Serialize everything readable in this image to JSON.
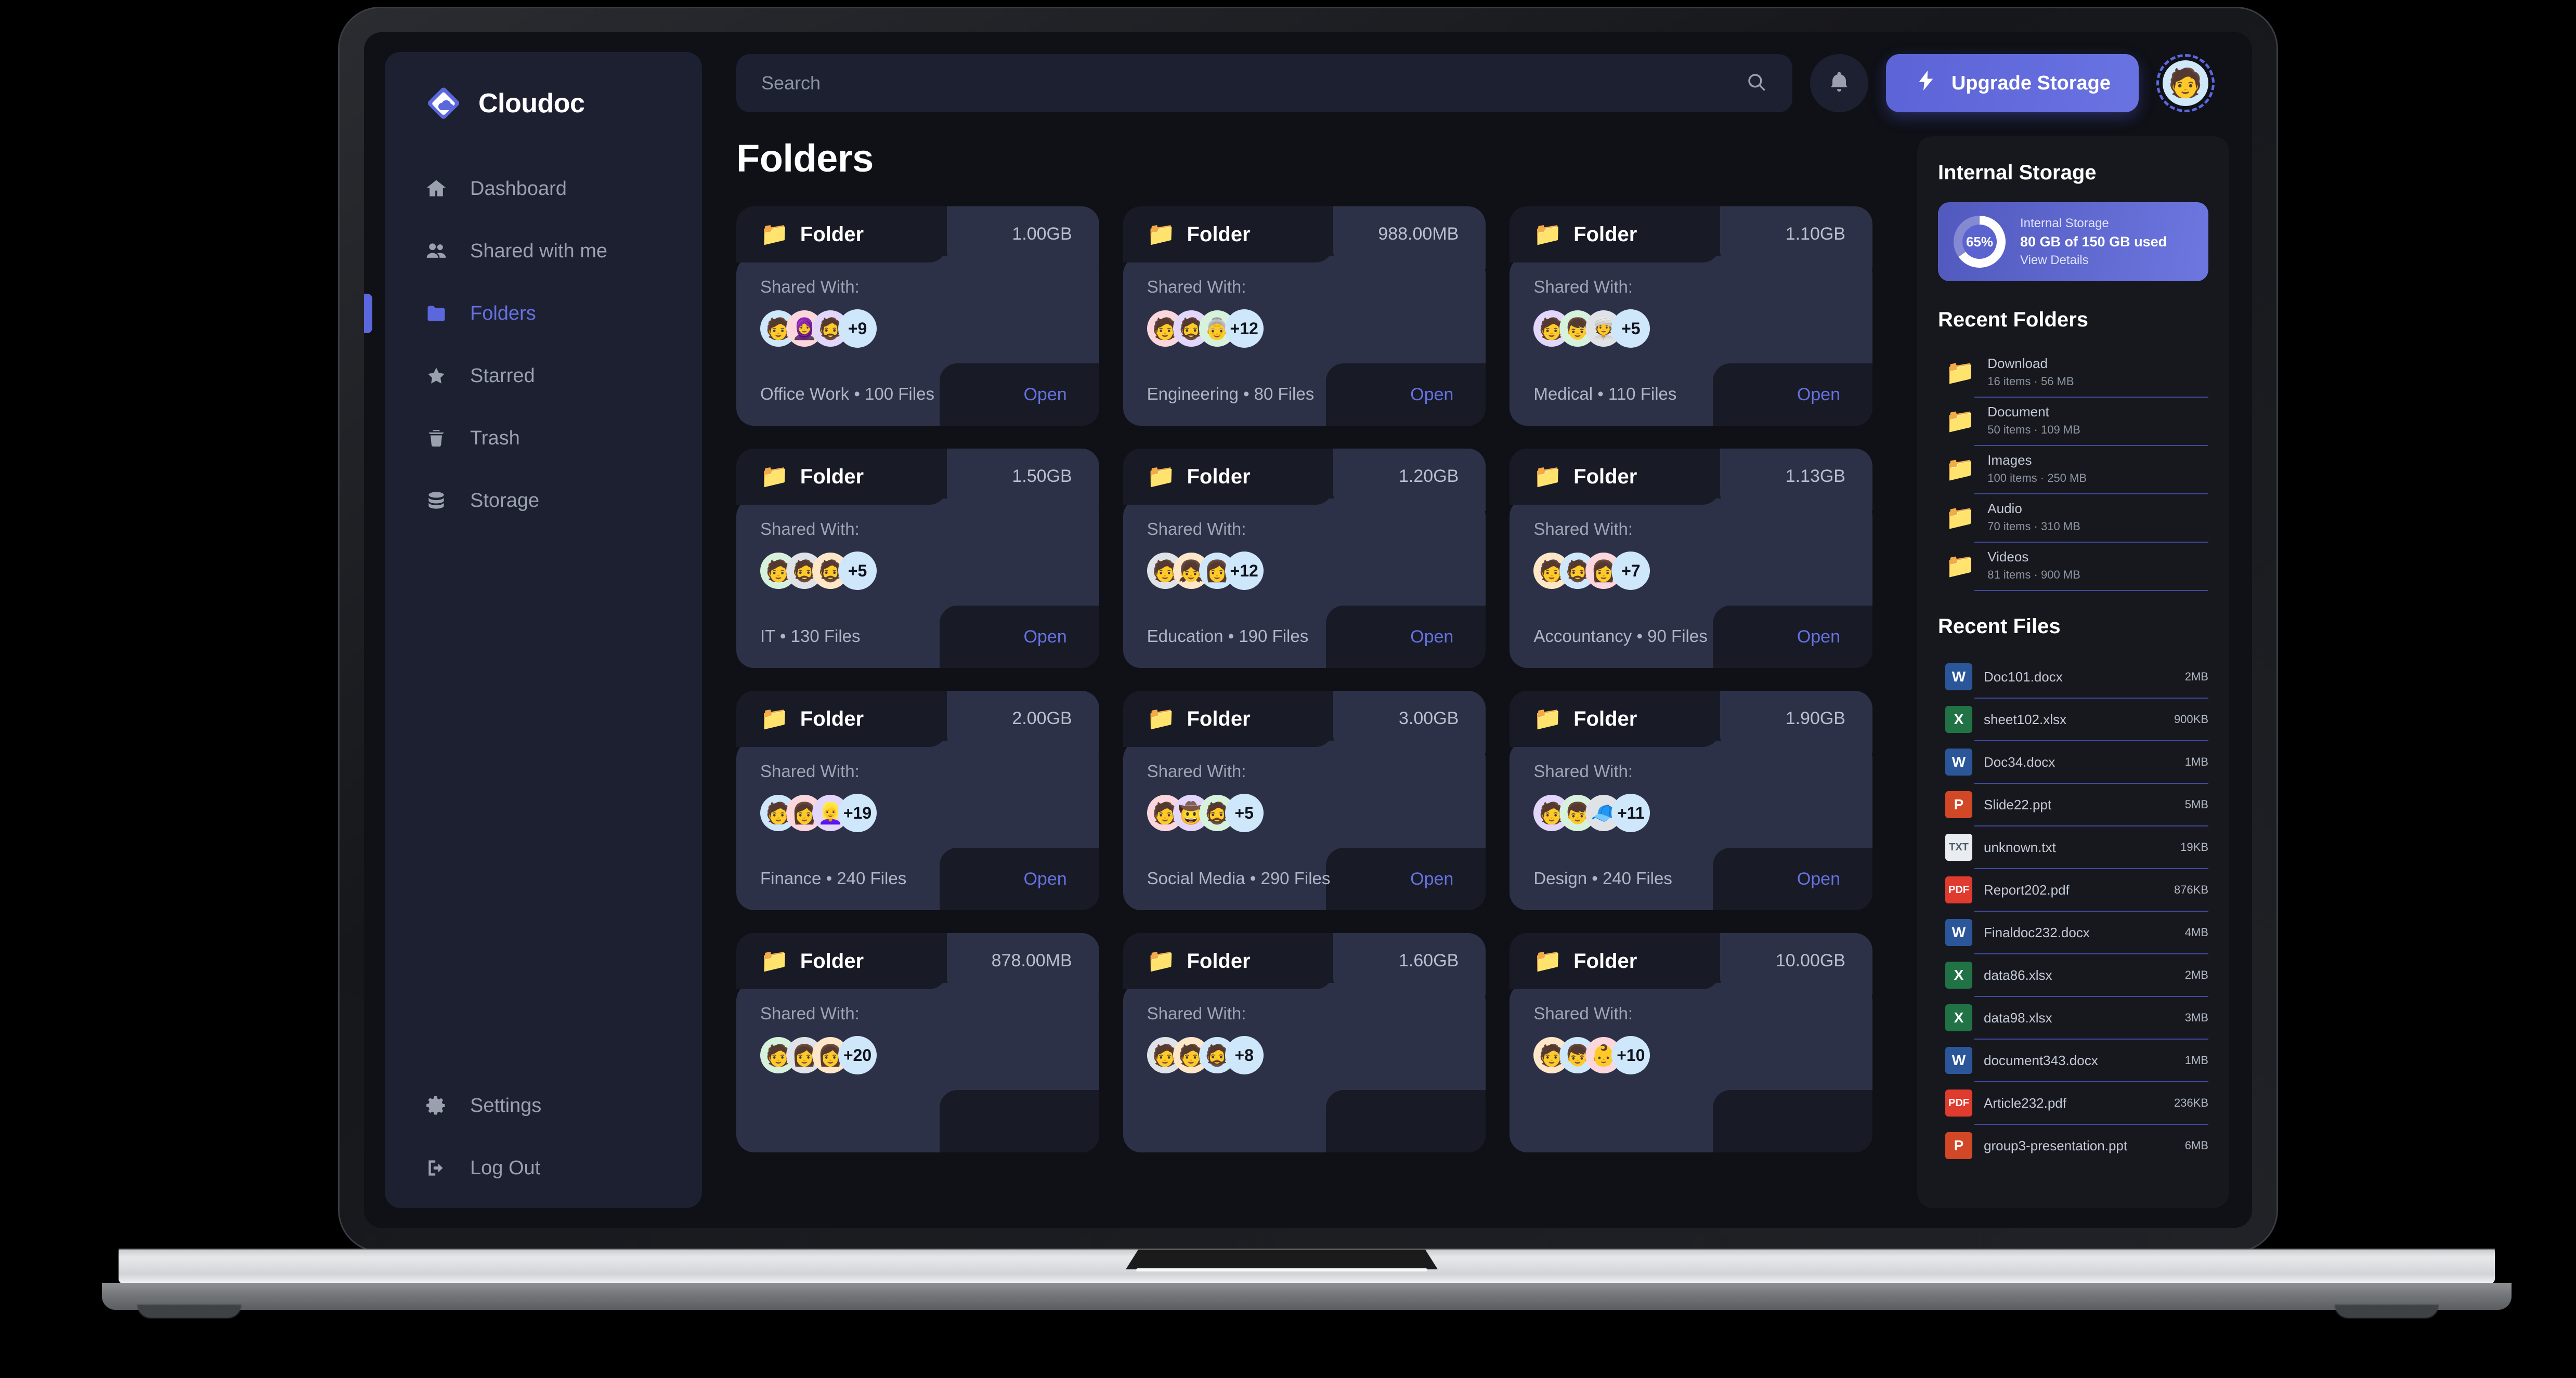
{
  "brand": {
    "name": "Cloudoc",
    "logo_icon": "cloud-diamond-logo",
    "accent": "#5b67dd"
  },
  "sidebar": {
    "items": [
      {
        "label": "Dashboard",
        "icon": "home-icon",
        "active": false
      },
      {
        "label": "Shared with me",
        "icon": "people-icon",
        "active": false
      },
      {
        "label": "Folders",
        "icon": "folder-icon",
        "active": true
      },
      {
        "label": "Starred",
        "icon": "star-icon",
        "active": false
      },
      {
        "label": "Trash",
        "icon": "trash-icon",
        "active": false
      },
      {
        "label": "Storage",
        "icon": "database-icon",
        "active": false
      }
    ],
    "bottom_items": [
      {
        "label": "Settings",
        "icon": "gear-icon"
      },
      {
        "label": "Log Out",
        "icon": "logout-icon"
      }
    ]
  },
  "topbar": {
    "search_placeholder": "Search",
    "search_value": "",
    "search_icon": "search-icon",
    "notifications_icon": "bell-icon",
    "upgrade_label": "Upgrade Storage",
    "upgrade_icon": "lightning-bolt-icon",
    "avatar_icon": "user-avatar"
  },
  "main": {
    "page_title": "Folders",
    "card_label": "Folder",
    "shared_with_label": "Shared With:",
    "open_label": "Open",
    "folder_icon": "folder-emoji",
    "cards": [
      {
        "size": "1.00GB",
        "extra": "+9",
        "name": "Office Work",
        "files": "100 Files",
        "footer": "Office Work • 100 Files",
        "avatars": [
          "🧑",
          "🧕",
          "🧔"
        ]
      },
      {
        "size": "988.00MB",
        "extra": "+12",
        "name": "Engineering",
        "files": "80 Files",
        "footer": "Engineering • 80 Files",
        "avatars": [
          "🧑",
          "🧔",
          "👵"
        ]
      },
      {
        "size": "1.10GB",
        "extra": "+5",
        "name": "Medical",
        "files": "110 Files",
        "footer": "Medical • 110 Files",
        "avatars": [
          "🧑",
          "👦",
          "👳"
        ]
      },
      {
        "size": "1.50GB",
        "extra": "+5",
        "name": "IT",
        "files": "130 Files",
        "footer": "IT • 130 Files",
        "avatars": [
          "🧑",
          "🧔",
          "🧔"
        ]
      },
      {
        "size": "1.20GB",
        "extra": "+12",
        "name": "Education",
        "files": "190 Files",
        "footer": "Education • 190 Files",
        "avatars": [
          "🧑",
          "👧",
          "👩"
        ]
      },
      {
        "size": "1.13GB",
        "extra": "+7",
        "name": "Accountancy",
        "files": "90 Files",
        "footer": "Accountancy • 90 Files",
        "avatars": [
          "🧑",
          "🧔",
          "👩"
        ]
      },
      {
        "size": "2.00GB",
        "extra": "+19",
        "name": "Finance",
        "files": "240 Files",
        "footer": "Finance • 240 Files",
        "avatars": [
          "🧑",
          "👩",
          "👱‍♀️"
        ]
      },
      {
        "size": "3.00GB",
        "extra": "+5",
        "name": "Social Media",
        "files": "290 Files",
        "footer": "Social Media • 290 Files",
        "avatars": [
          "🧑",
          "🤠",
          "🧔"
        ]
      },
      {
        "size": "1.90GB",
        "extra": "+11",
        "name": "Design",
        "files": "240 Files",
        "footer": "Design • 240 Files",
        "avatars": [
          "🧑",
          "👦",
          "🧢"
        ]
      },
      {
        "size": "878.00MB",
        "extra": "+20",
        "name": "",
        "files": "",
        "footer": "",
        "avatars": [
          "🧑",
          "👩",
          "👩"
        ]
      },
      {
        "size": "1.60GB",
        "extra": "+8",
        "name": "",
        "files": "",
        "footer": "",
        "avatars": [
          "🧑",
          "🧑",
          "🧔"
        ]
      },
      {
        "size": "10.00GB",
        "extra": "+10",
        "name": "",
        "files": "",
        "footer": "",
        "avatars": [
          "🧑",
          "👦",
          "👶"
        ]
      }
    ]
  },
  "rail": {
    "storage_heading": "Internal Storage",
    "storage_card": {
      "percent": "65%",
      "percent_value": 65,
      "title": "Internal Storage",
      "used": "80 GB of 150 GB used",
      "link": "View Details"
    },
    "recent_folders_heading": "Recent Folders",
    "recent_folders": [
      {
        "name": "Download",
        "meta": "16 items · 56 MB",
        "icon": "folder-emoji"
      },
      {
        "name": "Document",
        "meta": "50 items · 109 MB",
        "icon": "folder-emoji"
      },
      {
        "name": "Images",
        "meta": "100 items · 250 MB",
        "icon": "folder-emoji"
      },
      {
        "name": "Audio",
        "meta": "70 items · 310 MB",
        "icon": "folder-emoji"
      },
      {
        "name": "Videos",
        "meta": "81 items · 900 MB",
        "icon": "folder-emoji"
      }
    ],
    "recent_files_heading": "Recent Files",
    "recent_files": [
      {
        "name": "Doc101.docx",
        "size": "2MB",
        "type": "word",
        "glyph": "W"
      },
      {
        "name": "sheet102.xlsx",
        "size": "900KB",
        "type": "excel",
        "glyph": "X"
      },
      {
        "name": "Doc34.docx",
        "size": "1MB",
        "type": "word",
        "glyph": "W"
      },
      {
        "name": "Slide22.ppt",
        "size": "5MB",
        "type": "ppt",
        "glyph": "P"
      },
      {
        "name": "unknown.txt",
        "size": "19KB",
        "type": "txt",
        "glyph": "TXT"
      },
      {
        "name": "Report202.pdf",
        "size": "876KB",
        "type": "pdf",
        "glyph": "PDF"
      },
      {
        "name": "Finaldoc232.docx",
        "size": "4MB",
        "type": "word",
        "glyph": "W"
      },
      {
        "name": "data86.xlsx",
        "size": "2MB",
        "type": "excel",
        "glyph": "X"
      },
      {
        "name": "data98.xlsx",
        "size": "3MB",
        "type": "excel",
        "glyph": "X"
      },
      {
        "name": "document343.docx",
        "size": "1MB",
        "type": "word",
        "glyph": "W"
      },
      {
        "name": "Article232.pdf",
        "size": "236KB",
        "type": "pdf",
        "glyph": "PDF"
      },
      {
        "name": "group3-presentation.ppt",
        "size": "6MB",
        "type": "ppt",
        "glyph": "P"
      }
    ]
  },
  "colors": {
    "accent": "#5b67dd",
    "card_head": "#181b26",
    "card_body": "#2d3148",
    "sidebar": "#1c2030",
    "page_bg": "#0f1117",
    "rail_bg": "#16181d",
    "word": "#2b579a",
    "excel": "#217346",
    "ppt": "#d24726",
    "pdf": "#e03b2f",
    "txt": "#e9edf2"
  }
}
